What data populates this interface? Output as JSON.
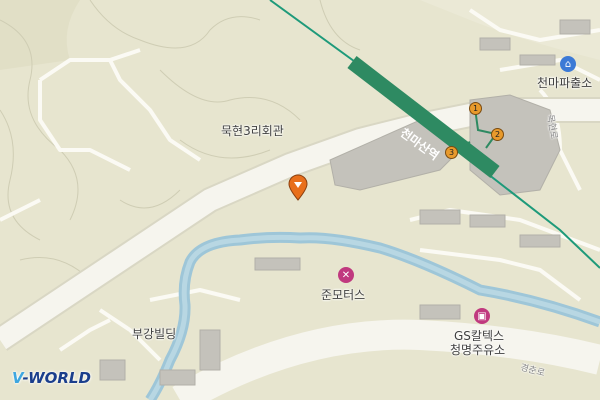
{
  "map": {
    "places": {
      "community_hall": "묵현3리회관",
      "police_box": "천마파출소",
      "station": "천마산역",
      "motors": "준모터스",
      "gas_station_line1": "GS칼텍스",
      "gas_station_line2": "청명주유소",
      "building": "부강빌딩"
    },
    "roads": {
      "road_east": "목현로",
      "road_south": "경춘로"
    },
    "station_exits": [
      "1",
      "2",
      "3"
    ],
    "logo": {
      "prefix": "V",
      "suffix": "-WORLD"
    },
    "colors": {
      "background": "#e7e5cf",
      "road": "#f6f5ee",
      "river": "#9ec6d8",
      "railway": "#1e9a7a",
      "station": "#2e8a62",
      "building": "#c4c2bb",
      "marker": "#e86f1b",
      "police": "#3c7ad6",
      "workshop": "#c0397f",
      "gas": "#c0397f"
    },
    "icons": [
      "location-pin-icon",
      "police-icon",
      "wrench-icon",
      "fuel-icon"
    ]
  }
}
